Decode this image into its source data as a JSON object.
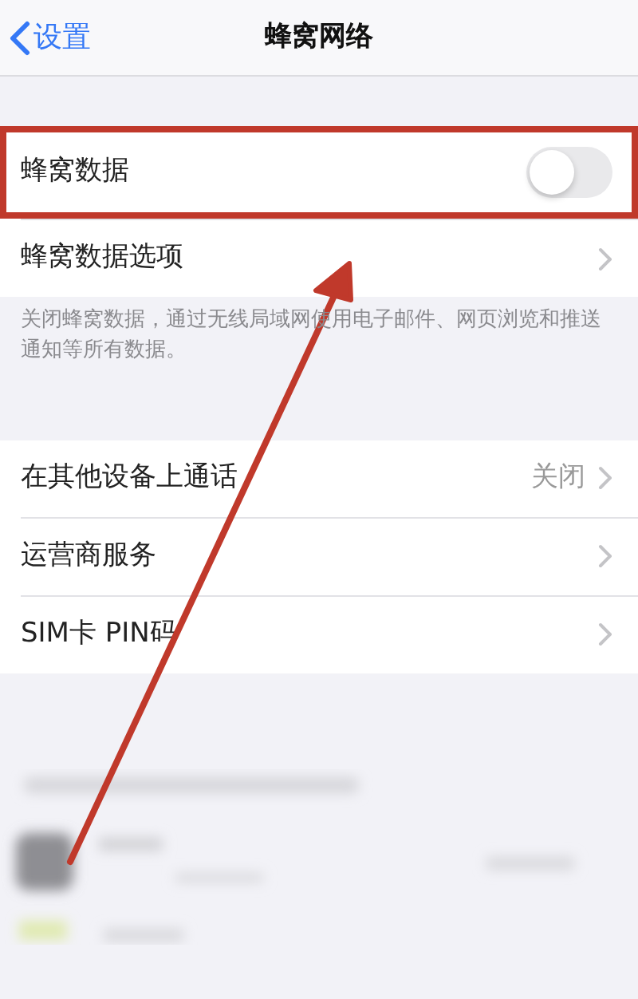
{
  "nav": {
    "back": "设置",
    "title": "蜂窝网络"
  },
  "groups": [
    {
      "rows": [
        {
          "kind": "toggle",
          "label": "蜂窝数据",
          "on": false,
          "highlighted": true
        },
        {
          "kind": "link",
          "label": "蜂窝数据选项"
        }
      ],
      "footer": "关闭蜂窝数据，通过无线局域网使用电子邮件、网页浏览和推送通知等所有数据。"
    },
    {
      "rows": [
        {
          "kind": "link",
          "label": "在其他设备上通话",
          "value": "关闭"
        },
        {
          "kind": "link",
          "label": "运营商服务"
        },
        {
          "kind": "link",
          "label": "SIM卡 PIN码"
        }
      ]
    }
  ]
}
